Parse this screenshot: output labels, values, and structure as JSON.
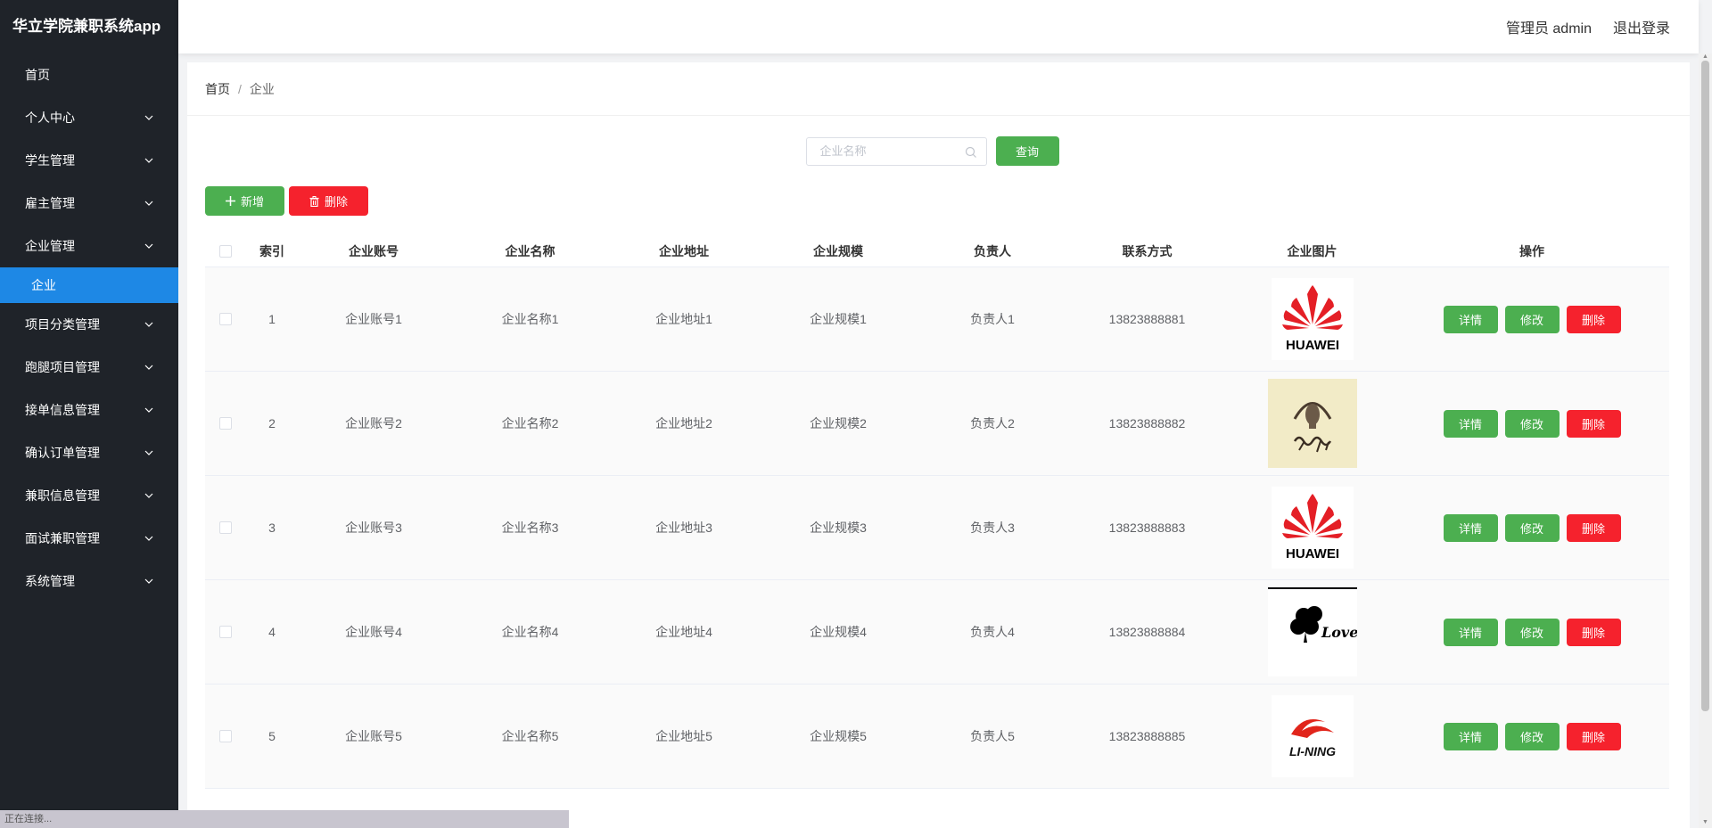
{
  "app": {
    "title": "华立学院兼职系统app"
  },
  "header": {
    "user": "管理员 admin",
    "logout": "退出登录"
  },
  "sidebar": {
    "items": [
      {
        "label": "首页",
        "has_chevron": false
      },
      {
        "label": "个人中心",
        "has_chevron": true
      },
      {
        "label": "学生管理",
        "has_chevron": true
      },
      {
        "label": "雇主管理",
        "has_chevron": true
      },
      {
        "label": "企业管理",
        "has_chevron": true
      },
      {
        "label": "项目分类管理",
        "has_chevron": true
      },
      {
        "label": "跑腿项目管理",
        "has_chevron": true
      },
      {
        "label": "接单信息管理",
        "has_chevron": true
      },
      {
        "label": "确认订单管理",
        "has_chevron": true
      },
      {
        "label": "兼职信息管理",
        "has_chevron": true
      },
      {
        "label": "面试兼职管理",
        "has_chevron": true
      },
      {
        "label": "系统管理",
        "has_chevron": true
      }
    ],
    "active_sub": "企业"
  },
  "breadcrumb": {
    "home": "首页",
    "sep": "/",
    "current": "企业"
  },
  "search": {
    "placeholder": "企业名称",
    "button": "查询"
  },
  "actions": {
    "add": "新增",
    "delete": "删除"
  },
  "table": {
    "headers": [
      "索引",
      "企业账号",
      "企业名称",
      "企业地址",
      "企业规模",
      "负责人",
      "联系方式",
      "企业图片",
      "操作"
    ],
    "row_buttons": {
      "detail": "详情",
      "edit": "修改",
      "delete": "删除"
    },
    "rows": [
      {
        "index": "1",
        "account": "企业账号1",
        "name": "企业名称1",
        "address": "企业地址1",
        "scale": "企业规模1",
        "owner": "负责人1",
        "phone": "13823888881",
        "logo": "huawei-logo"
      },
      {
        "index": "2",
        "account": "企业账号2",
        "name": "企业名称2",
        "address": "企业地址2",
        "scale": "企业规模2",
        "owner": "负责人2",
        "phone": "13823888882",
        "logo": "calligraphy-logo"
      },
      {
        "index": "3",
        "account": "企业账号3",
        "name": "企业名称3",
        "address": "企业地址3",
        "scale": "企业规模3",
        "owner": "负责人3",
        "phone": "13823888883",
        "logo": "huawei-logo"
      },
      {
        "index": "4",
        "account": "企业账号4",
        "name": "企业名称4",
        "address": "企业地址4",
        "scale": "企业规模4",
        "owner": "负责人4",
        "phone": "13823888884",
        "logo": "clover-love-logo"
      },
      {
        "index": "5",
        "account": "企业账号5",
        "name": "企业名称5",
        "address": "企业地址5",
        "scale": "企业规模5",
        "owner": "负责人5",
        "phone": "13823888885",
        "logo": "li-ning-logo"
      }
    ]
  },
  "status_bar": "正在连接...",
  "colors": {
    "sidebar_bg": "#1f2329",
    "active_blue": "#1e88e5",
    "green": "#4caf50",
    "red": "#f5222d"
  }
}
